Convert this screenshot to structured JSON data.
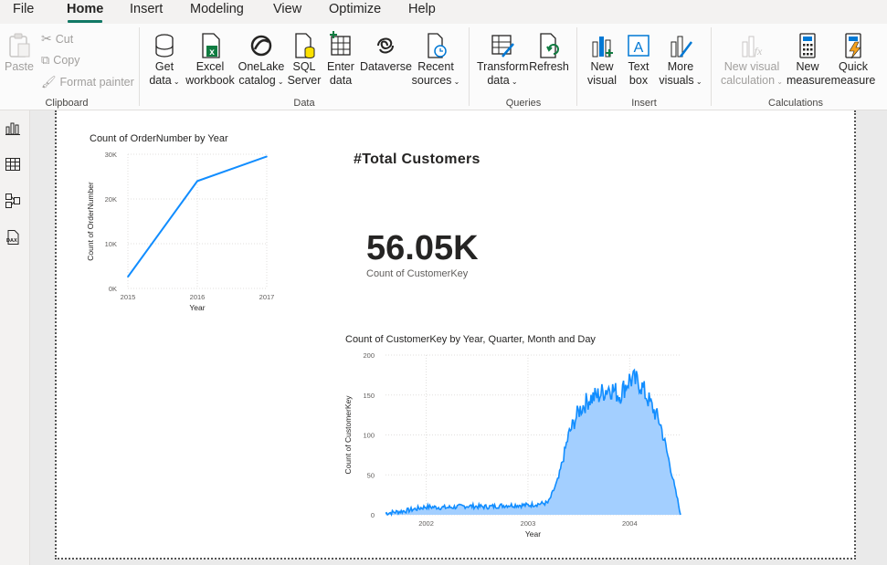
{
  "menu": {
    "tabs": [
      {
        "label": "File"
      },
      {
        "label": "Home",
        "active": true
      },
      {
        "label": "Insert"
      },
      {
        "label": "Modeling"
      },
      {
        "label": "View"
      },
      {
        "label": "Optimize"
      },
      {
        "label": "Help"
      }
    ],
    "accent_color": "#117865"
  },
  "ribbon": {
    "clipboard": {
      "paste": "Paste",
      "cut": "Cut",
      "copy": "Copy",
      "format_painter": "Format painter",
      "group": "Clipboard"
    },
    "data": {
      "get_data": [
        "Get",
        "data"
      ],
      "excel": [
        "Excel",
        "workbook"
      ],
      "onelake": [
        "OneLake",
        "catalog"
      ],
      "sql": [
        "SQL",
        "Server"
      ],
      "enter": [
        "Enter",
        "data"
      ],
      "dataverse": "Dataverse",
      "recent": [
        "Recent",
        "sources"
      ],
      "group": "Data"
    },
    "queries": {
      "transform": [
        "Transform",
        "data"
      ],
      "refresh": "Refresh",
      "group": "Queries"
    },
    "insert": {
      "new_visual": [
        "New",
        "visual"
      ],
      "text_box": [
        "Text",
        "box"
      ],
      "more_visuals": [
        "More",
        "visuals"
      ],
      "group": "Insert"
    },
    "calculations": {
      "new_visual_calc": [
        "New visual",
        "calculation"
      ],
      "new_measure": [
        "New",
        "measure"
      ],
      "quick_measure": [
        "Quick",
        "measure"
      ],
      "group": "Calculations"
    }
  },
  "left_rail": {
    "icons": [
      "report-view-icon",
      "table-view-icon",
      "model-view-icon",
      "dax-query-view-icon"
    ]
  },
  "report": {
    "line_chart_title": "Count of OrderNumber by Year",
    "card": {
      "title": "#Total Customers",
      "value": "56.05K",
      "label": "Count of CustomerKey"
    },
    "area_chart_title": "Count of CustomerKey by Year, Quarter, Month and Day"
  },
  "chart_data": [
    {
      "type": "line",
      "title": "Count of OrderNumber by Year",
      "xlabel": "Year",
      "ylabel": "Count of OrderNumber",
      "categories": [
        "2015",
        "2016",
        "2017"
      ],
      "values": [
        2600,
        24000,
        29500
      ],
      "ylim": [
        0,
        30000
      ],
      "yticks": [
        "0K",
        "10K",
        "20K",
        "30K"
      ],
      "color": "#118dff",
      "grid": true
    },
    {
      "type": "area",
      "title": "Count of CustomerKey by Year, Quarter, Month and Day",
      "xlabel": "Year",
      "ylabel": "Count of CustomerKey",
      "xticks": [
        "2002",
        "2003",
        "2004"
      ],
      "x": [
        2001.6,
        2001.8,
        2002.0,
        2002.2,
        2002.4,
        2002.6,
        2002.8,
        2003.0,
        2003.2,
        2003.3,
        2003.4,
        2003.5,
        2003.6,
        2003.7,
        2003.8,
        2003.9,
        2004.0,
        2004.1,
        2004.2,
        2004.3,
        2004.4,
        2004.45,
        2004.5
      ],
      "values": [
        2,
        5,
        10,
        9,
        11,
        10,
        12,
        12,
        15,
        45,
        100,
        130,
        145,
        150,
        160,
        150,
        170,
        165,
        140,
        115,
        60,
        30,
        2
      ],
      "ylim": [
        0,
        200
      ],
      "yticks": [
        "0",
        "50",
        "100",
        "150",
        "200"
      ],
      "line_color": "#118dff",
      "fill_color": "#a3cfff",
      "grid": true
    }
  ]
}
